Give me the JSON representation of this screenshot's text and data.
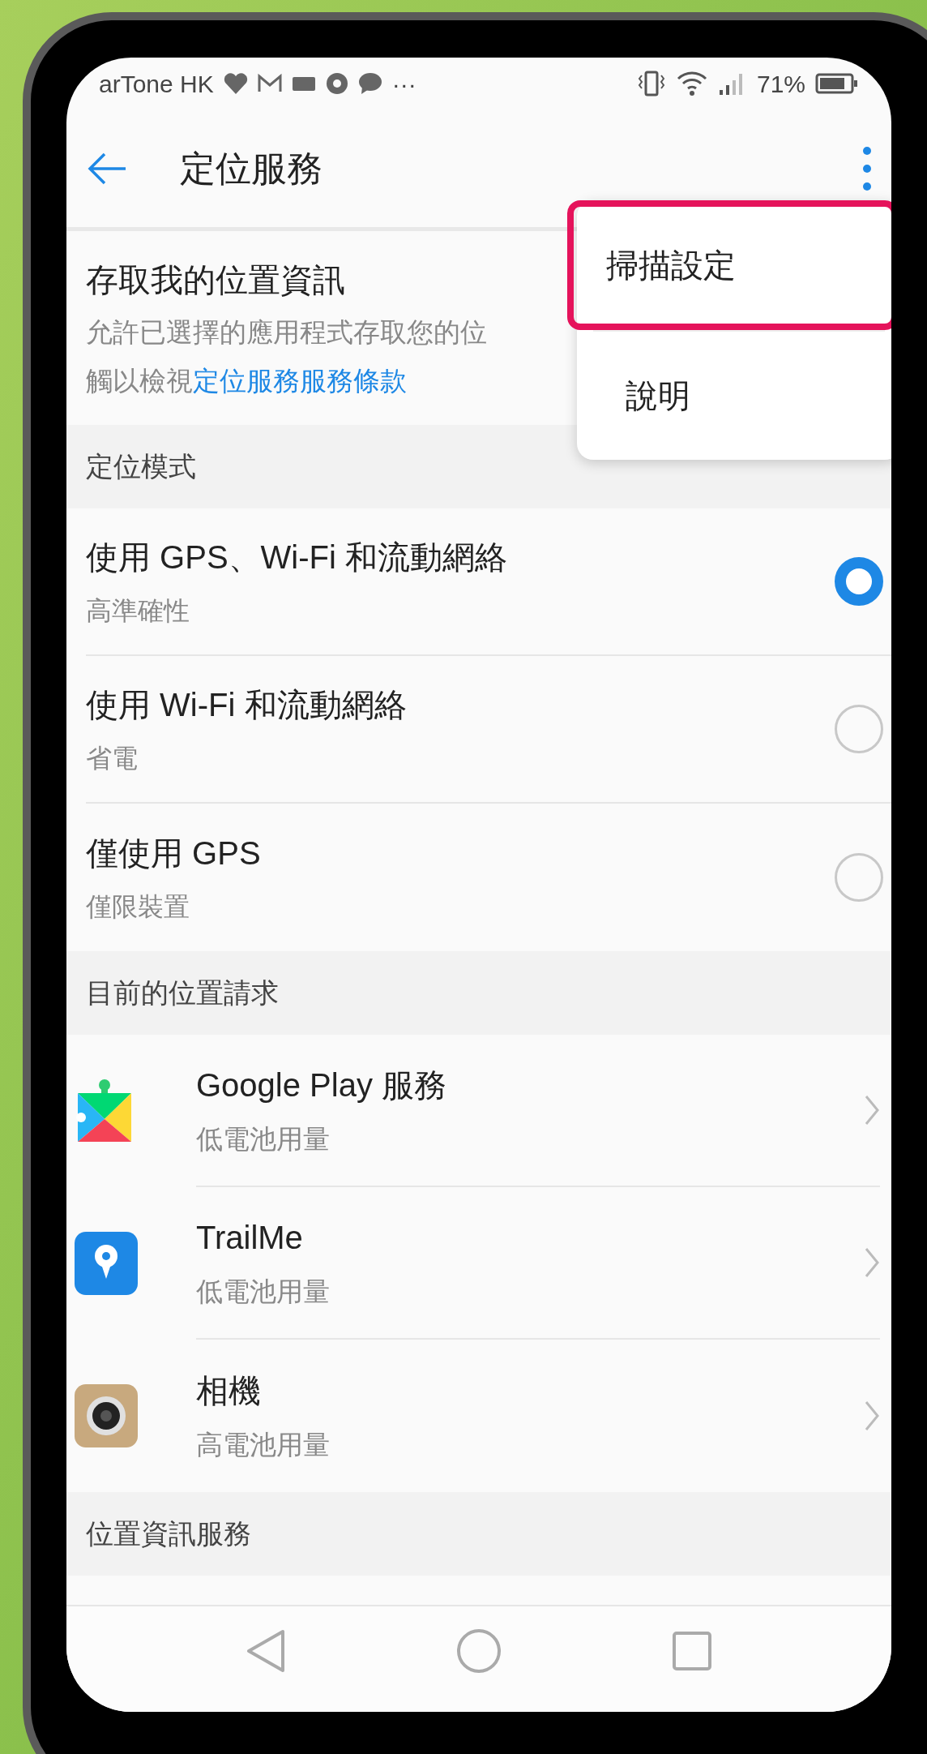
{
  "status_bar": {
    "carrier": "arTone HK",
    "more": "···",
    "battery": "71%"
  },
  "header": {
    "title": "定位服務"
  },
  "access": {
    "title": "存取我的位置資訊",
    "description": "允許已選擇的應用程式存取您的位",
    "note": "觸以檢視",
    "link": "定位服務服務條款"
  },
  "sections": [
    {
      "heading": "定位模式",
      "kind": "radio",
      "items": [
        {
          "title": "使用 GPS、Wi-Fi 和流動網絡",
          "subtitle": "高準確性",
          "selected": true
        },
        {
          "title": "使用 Wi-Fi 和流動網絡",
          "subtitle": "省電",
          "selected": false
        },
        {
          "title": "僅使用 GPS",
          "subtitle": "僅限裝置",
          "selected": false
        }
      ]
    },
    {
      "heading": "目前的位置請求",
      "kind": "app",
      "items": [
        {
          "title": "Google Play 服務",
          "subtitle": "低電池用量"
        },
        {
          "title": "TrailMe",
          "subtitle": "低電池用量"
        },
        {
          "title": "相機",
          "subtitle": "高電池用量"
        }
      ]
    },
    {
      "heading": "位置資訊服務",
      "kind": "partial"
    }
  ],
  "menu": {
    "items": [
      {
        "label": "掃描設定",
        "highlighted": true
      },
      {
        "label": "說明",
        "highlighted": false
      }
    ]
  }
}
